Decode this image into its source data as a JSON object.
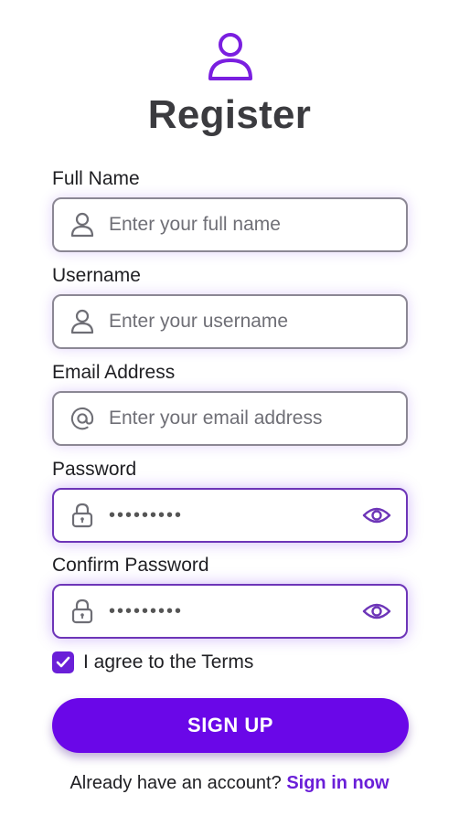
{
  "header": {
    "icon": "user-icon",
    "title": "Register"
  },
  "form": {
    "full_name": {
      "label": "Full Name",
      "placeholder": "Enter your full name",
      "icon": "user-icon"
    },
    "username": {
      "label": "Username",
      "placeholder": "Enter your username",
      "icon": "user-icon"
    },
    "email": {
      "label": "Email Address",
      "placeholder": "Enter your email address",
      "icon": "at-icon"
    },
    "password": {
      "label": "Password",
      "value": "•••••••••",
      "icon": "lock-icon",
      "toggle_icon": "eye-icon"
    },
    "confirm_password": {
      "label": "Confirm Password",
      "value": "•••••••••",
      "icon": "lock-icon",
      "toggle_icon": "eye-icon"
    },
    "terms": {
      "checked": true,
      "label": "I agree to the Terms"
    },
    "submit_label": "SIGN UP"
  },
  "footer": {
    "prompt": "Already have an account?",
    "link": "Sign in now"
  },
  "colors": {
    "accent": "#6a07e8",
    "link": "#6a1fd8",
    "border": "#8b8794",
    "glow": "#7c3aed"
  }
}
